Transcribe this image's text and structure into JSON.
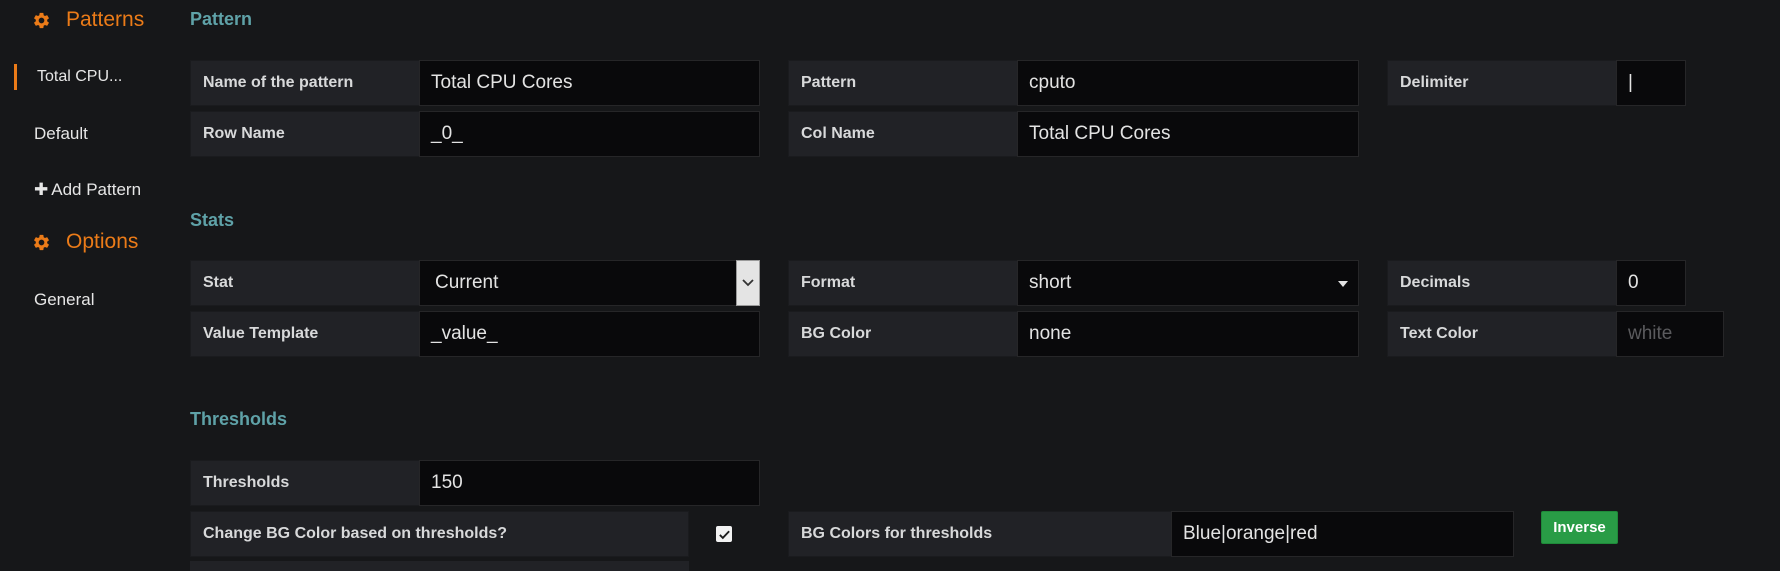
{
  "sidebar": {
    "patterns_heading": "Patterns",
    "pattern_items": [
      {
        "label": "Total CPU...",
        "active": true
      },
      {
        "label": "Default"
      }
    ],
    "add_pattern_label": "Add Pattern",
    "options_heading": "Options",
    "option_items": [
      {
        "label": "General"
      }
    ]
  },
  "pattern_section": {
    "title": "Pattern",
    "name_label": "Name of the pattern",
    "name_value": "Total CPU Cores",
    "pattern_label": "Pattern",
    "pattern_value": "cputo",
    "delimiter_label": "Delimiter",
    "delimiter_value": "|",
    "row_name_label": "Row Name",
    "row_name_value": "_0_",
    "col_name_label": "Col Name",
    "col_name_value": "Total CPU Cores"
  },
  "stats_section": {
    "title": "Stats",
    "stat_label": "Stat",
    "stat_value": "Current",
    "format_label": "Format",
    "format_value": "short",
    "decimals_label": "Decimals",
    "decimals_value": "0",
    "value_template_label": "Value Template",
    "value_template_value": "_value_",
    "bg_color_label": "BG Color",
    "bg_color_value": "none",
    "text_color_label": "Text Color",
    "text_color_placeholder": "white"
  },
  "thresholds_section": {
    "title": "Thresholds",
    "thresholds_label": "Thresholds",
    "thresholds_value": "150",
    "change_bg_label": "Change BG Color based on thresholds?",
    "change_bg_checked": true,
    "bg_colors_label": "BG Colors for thresholds",
    "bg_colors_value": "Blue|orange|red",
    "inverse_button": "Inverse"
  },
  "icons": {
    "gear": "gear-icon",
    "plus": "plus-icon",
    "checkmark": "checkmark-icon",
    "chevron": "chevron-down-icon",
    "caret": "caret-down-icon"
  },
  "colors": {
    "accent": "#eb7b18",
    "section_title": "#5fa2a8",
    "background": "#161719",
    "button_green": "#299c46"
  }
}
